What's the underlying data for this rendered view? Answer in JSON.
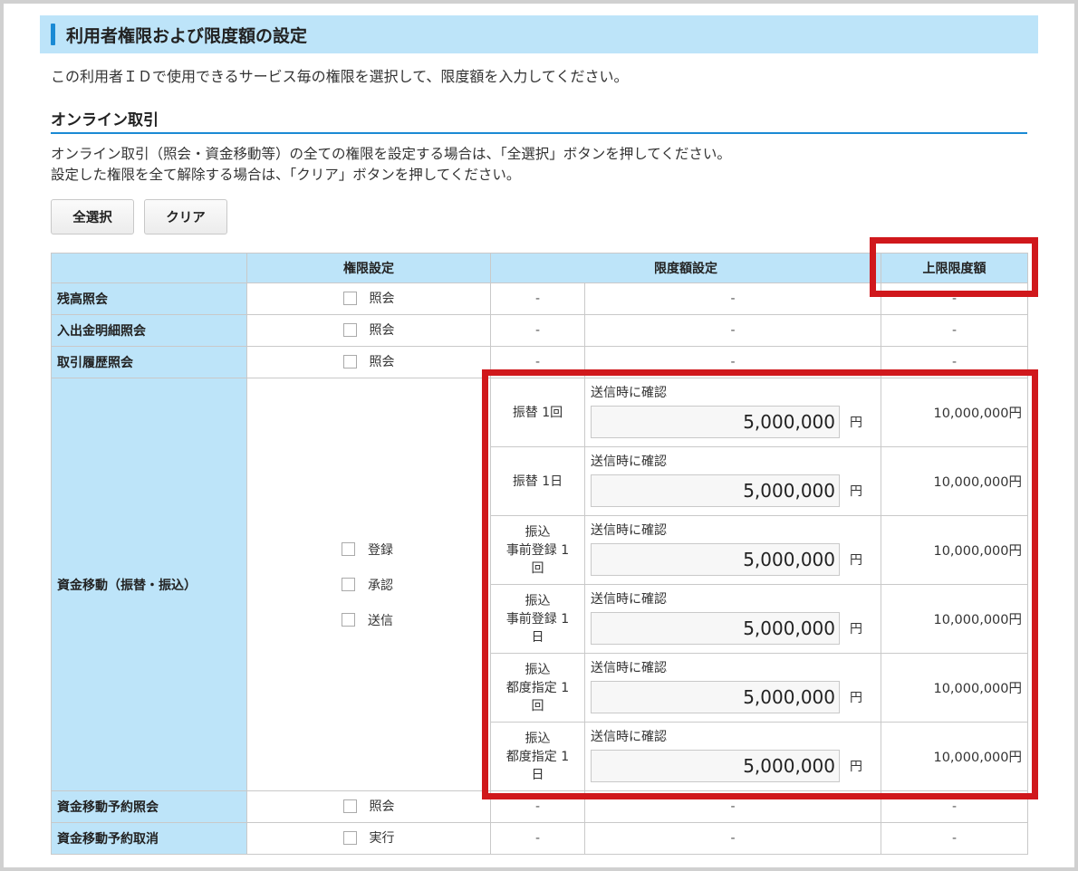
{
  "title": "利用者権限および限度額の設定",
  "intro": "この利用者ＩＤで使用できるサービス毎の権限を選択して、限度額を入力してください。",
  "section": "オンライン取引",
  "desc_line1": "オンライン取引（照会・資金移動等）の全ての権限を設定する場合は、「全選択」ボタンを押してください。",
  "desc_line2": "設定した権限を全て解除する場合は、「クリア」ボタンを押してください。",
  "buttons": {
    "select_all": "全選択",
    "clear": "クリア"
  },
  "headers": {
    "blank": "",
    "permission": "権限設定",
    "limit": "限度額設定",
    "max": "上限限度額"
  },
  "dash": "-",
  "rows": {
    "balance": {
      "label": "残高照会",
      "perm": "照会"
    },
    "detail": {
      "label": "入出金明細照会",
      "perm": "照会"
    },
    "history": {
      "label": "取引履歴照会",
      "perm": "照会"
    },
    "transfer": {
      "label": "資金移動（振替・振込）",
      "perms": [
        "登録",
        "承認",
        "送信"
      ],
      "limits": [
        {
          "label_lines": [
            "振替 1回"
          ],
          "confirm": "送信時に確認",
          "value": "5,000,000",
          "unit": "円",
          "max": "10,000,000円"
        },
        {
          "label_lines": [
            "振替 1日"
          ],
          "confirm": "送信時に確認",
          "value": "5,000,000",
          "unit": "円",
          "max": "10,000,000円"
        },
        {
          "label_lines": [
            "振込",
            "事前登録 1",
            "回"
          ],
          "confirm": "送信時に確認",
          "value": "5,000,000",
          "unit": "円",
          "max": "10,000,000円"
        },
        {
          "label_lines": [
            "振込",
            "事前登録 1",
            "日"
          ],
          "confirm": "送信時に確認",
          "value": "5,000,000",
          "unit": "円",
          "max": "10,000,000円"
        },
        {
          "label_lines": [
            "振込",
            "都度指定 1",
            "回"
          ],
          "confirm": "送信時に確認",
          "value": "5,000,000",
          "unit": "円",
          "max": "10,000,000円"
        },
        {
          "label_lines": [
            "振込",
            "都度指定 1",
            "日"
          ],
          "confirm": "送信時に確認",
          "value": "5,000,000",
          "unit": "円",
          "max": "10,000,000円"
        }
      ]
    },
    "reserve_inquiry": {
      "label": "資金移動予約照会",
      "perm": "照会"
    },
    "reserve_cancel": {
      "label": "資金移動予約取消",
      "perm": "実行"
    }
  },
  "highlight_color": "#d0181c"
}
